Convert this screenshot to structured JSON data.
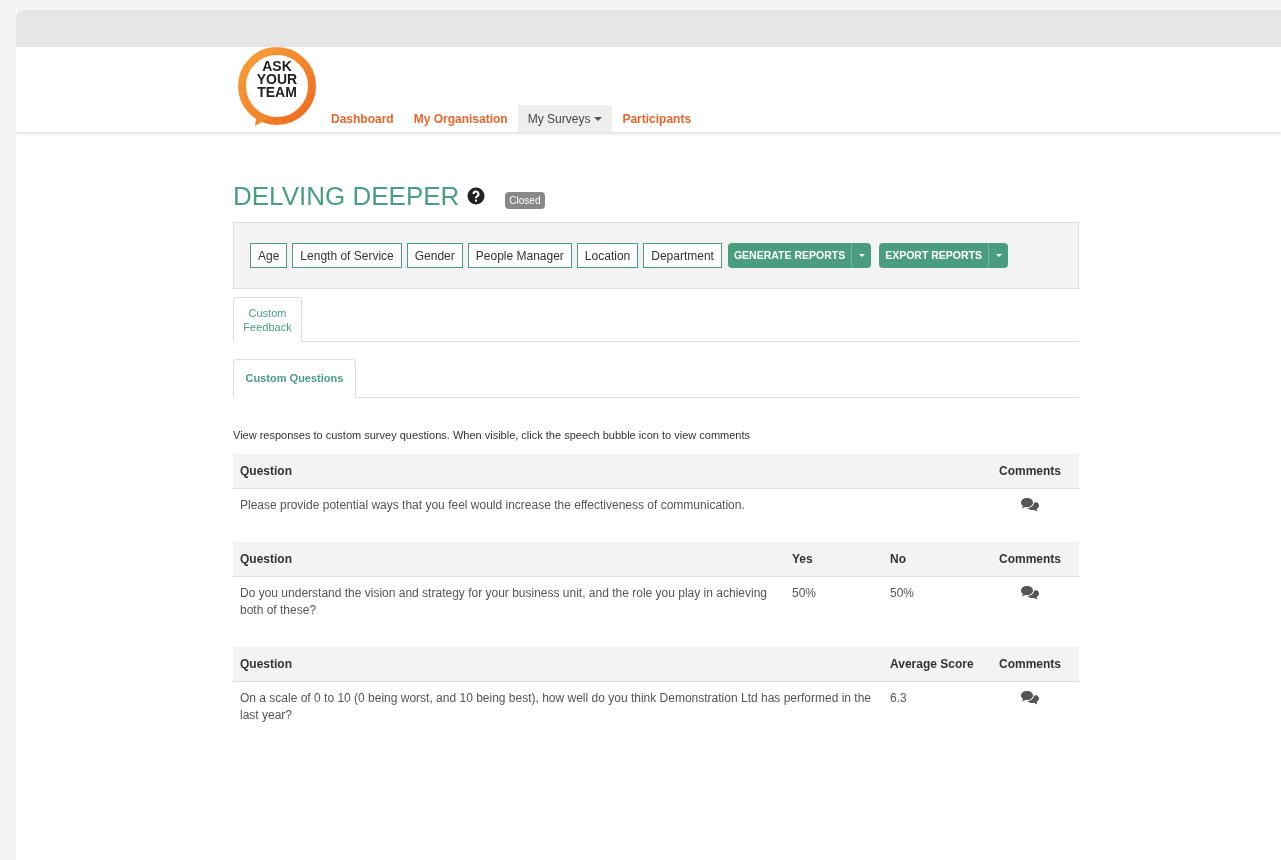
{
  "logo": {
    "text": "ASK YOUR TEAM"
  },
  "nav": [
    {
      "label": "Dashboard",
      "selected": false,
      "dropdown": false
    },
    {
      "label": "My Organisation",
      "selected": false,
      "dropdown": false
    },
    {
      "label": "My Surveys",
      "selected": true,
      "dropdown": true
    },
    {
      "label": "Participants",
      "selected": false,
      "dropdown": false
    }
  ],
  "survey": {
    "title": "DELVING DEEPER",
    "status": "Closed"
  },
  "filters": [
    "Age",
    "Length of Service",
    "Gender",
    "People Manager",
    "Location",
    "Department"
  ],
  "report_buttons": [
    "GENERATE REPORTS",
    "EXPORT REPORTS"
  ],
  "tabs": [
    {
      "label": "Custom Feedback",
      "selected": true
    }
  ],
  "subtabs": [
    {
      "label": "Custom Questions",
      "selected": true
    }
  ],
  "intro": "View responses to custom survey questions. When visible, click the speech bubble icon to view comments",
  "tables": [
    {
      "columns": [
        "Question",
        "Comments"
      ],
      "rows": [
        {
          "cells": [
            "Please provide potential ways that you feel would increase the effectiveness of communication."
          ],
          "comments": true
        }
      ]
    },
    {
      "columns": [
        "Question",
        "Yes",
        "No",
        "Comments"
      ],
      "rows": [
        {
          "cells": [
            "Do you understand the vision and strategy for your business unit, and the role you play in achieving both of these?",
            "50%",
            "50%"
          ],
          "comments": true
        }
      ]
    },
    {
      "columns": [
        "Question",
        "Average Score",
        "Comments"
      ],
      "rows": [
        {
          "cells": [
            "On a scale of 0 to 10 (0 being worst, and 10 being best), how well do you think Demonstration Ltd has performed in the last year?",
            "6.3"
          ],
          "comments": true
        }
      ]
    }
  ]
}
